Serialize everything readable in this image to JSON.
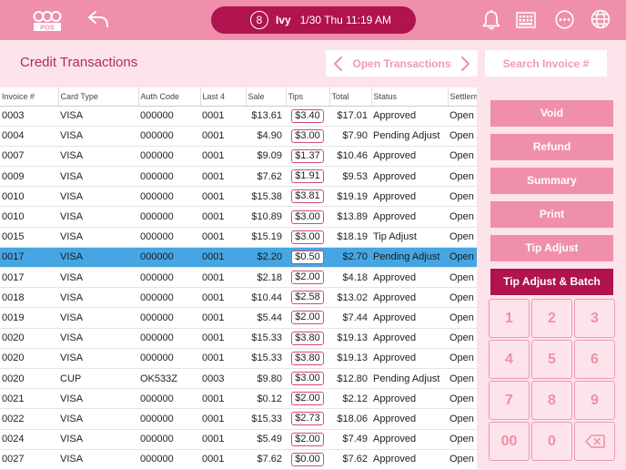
{
  "topbar": {
    "logo_text": "POS",
    "user_badge": "8",
    "user_name": "Ivy",
    "datetime": "1/30 Thu 11:19 AM",
    "icons": [
      "back-arrow-icon",
      "bell-icon",
      "cash-drawer-icon",
      "more-options-icon",
      "globe-icon"
    ]
  },
  "page": {
    "title": "Credit Transactions",
    "nav_label": "Open Transactions",
    "search_placeholder": "Search Invoice #"
  },
  "table": {
    "columns": [
      "Invoice #",
      "Card Type",
      "Auth Code",
      "Last 4",
      "Sale",
      "Tips",
      "Total",
      "Status",
      "Settlem"
    ],
    "rows": [
      {
        "invoice": "0003",
        "card": "VISA",
        "auth": "000000",
        "last4": "0001",
        "sale": "$13.61",
        "tips": "$3.40",
        "total": "$17.01",
        "status": "Approved",
        "settle": "Open"
      },
      {
        "invoice": "0004",
        "card": "VISA",
        "auth": "000000",
        "last4": "0001",
        "sale": "$4.90",
        "tips": "$3.00",
        "total": "$7.90",
        "status": "Pending Adjust",
        "settle": "Open"
      },
      {
        "invoice": "0007",
        "card": "VISA",
        "auth": "000000",
        "last4": "0001",
        "sale": "$9.09",
        "tips": "$1.37",
        "total": "$10.46",
        "status": "Approved",
        "settle": "Open"
      },
      {
        "invoice": "0009",
        "card": "VISA",
        "auth": "000000",
        "last4": "0001",
        "sale": "$7.62",
        "tips": "$1.91",
        "total": "$9.53",
        "status": "Approved",
        "settle": "Open"
      },
      {
        "invoice": "0010",
        "card": "VISA",
        "auth": "000000",
        "last4": "0001",
        "sale": "$15.38",
        "tips": "$3.81",
        "total": "$19.19",
        "status": "Approved",
        "settle": "Open"
      },
      {
        "invoice": "0010",
        "card": "VISA",
        "auth": "000000",
        "last4": "0001",
        "sale": "$10.89",
        "tips": "$3.00",
        "total": "$13.89",
        "status": "Approved",
        "settle": "Open"
      },
      {
        "invoice": "0015",
        "card": "VISA",
        "auth": "000000",
        "last4": "0001",
        "sale": "$15.19",
        "tips": "$3.00",
        "total": "$18.19",
        "status": "Tip Adjust",
        "settle": "Open"
      },
      {
        "invoice": "0017",
        "card": "VISA",
        "auth": "000000",
        "last4": "0001",
        "sale": "$2.20",
        "tips": "$0.50",
        "total": "$2.70",
        "status": "Pending Adjust",
        "settle": "Open",
        "selected": true
      },
      {
        "invoice": "0017",
        "card": "VISA",
        "auth": "000000",
        "last4": "0001",
        "sale": "$2.18",
        "tips": "$2.00",
        "total": "$4.18",
        "status": "Approved",
        "settle": "Open"
      },
      {
        "invoice": "0018",
        "card": "VISA",
        "auth": "000000",
        "last4": "0001",
        "sale": "$10.44",
        "tips": "$2.58",
        "total": "$13.02",
        "status": "Approved",
        "settle": "Open"
      },
      {
        "invoice": "0019",
        "card": "VISA",
        "auth": "000000",
        "last4": "0001",
        "sale": "$5.44",
        "tips": "$2.00",
        "total": "$7.44",
        "status": "Approved",
        "settle": "Open"
      },
      {
        "invoice": "0020",
        "card": "VISA",
        "auth": "000000",
        "last4": "0001",
        "sale": "$15.33",
        "tips": "$3.80",
        "total": "$19.13",
        "status": "Approved",
        "settle": "Open"
      },
      {
        "invoice": "0020",
        "card": "VISA",
        "auth": "000000",
        "last4": "0001",
        "sale": "$15.33",
        "tips": "$3.80",
        "total": "$19.13",
        "status": "Approved",
        "settle": "Open"
      },
      {
        "invoice": "0020",
        "card": "CUP",
        "auth": "OK533Z",
        "last4": "0003",
        "sale": "$9.80",
        "tips": "$3.00",
        "total": "$12.80",
        "status": "Pending Adjust",
        "settle": "Open"
      },
      {
        "invoice": "0021",
        "card": "VISA",
        "auth": "000000",
        "last4": "0001",
        "sale": "$0.12",
        "tips": "$2.00",
        "total": "$2.12",
        "status": "Approved",
        "settle": "Open"
      },
      {
        "invoice": "0022",
        "card": "VISA",
        "auth": "000000",
        "last4": "0001",
        "sale": "$15.33",
        "tips": "$2.73",
        "total": "$18.06",
        "status": "Approved",
        "settle": "Open"
      },
      {
        "invoice": "0024",
        "card": "VISA",
        "auth": "000000",
        "last4": "0001",
        "sale": "$5.49",
        "tips": "$2.00",
        "total": "$7.49",
        "status": "Approved",
        "settle": "Open"
      },
      {
        "invoice": "0027",
        "card": "VISA",
        "auth": "000000",
        "last4": "0001",
        "sale": "$7.62",
        "tips": "$0.00",
        "total": "$7.62",
        "status": "Approved",
        "settle": "Open"
      }
    ]
  },
  "actions": {
    "void": "Void",
    "refund": "Refund",
    "summary": "Summary",
    "print": "Print",
    "tip_adjust": "Tip Adjust",
    "tip_adjust_batch": "Tip Adjust & Batch"
  },
  "keypad": {
    "keys": [
      "1",
      "2",
      "3",
      "4",
      "5",
      "6",
      "7",
      "8",
      "9",
      "00",
      "0",
      "backspace"
    ]
  },
  "colors": {
    "topbar": "#ef8fab",
    "accent_dark": "#b0134e",
    "background": "#fde3ea",
    "selected_row": "#46a6e3",
    "button": "#ef8fab",
    "muted_text": "#ef9ab5"
  }
}
